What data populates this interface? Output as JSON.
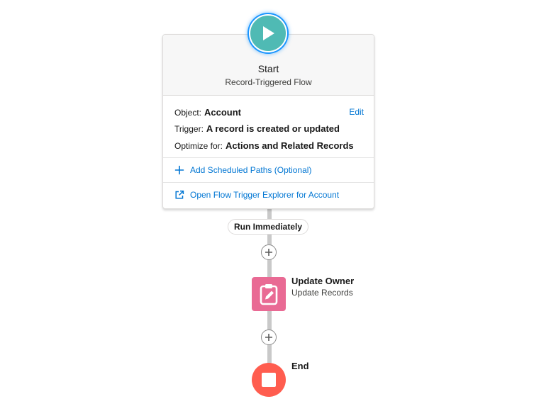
{
  "start": {
    "title": "Start",
    "subtitle": "Record-Triggered Flow",
    "object_label": "Object:",
    "object_value": "Account",
    "trigger_label": "Trigger:",
    "trigger_value": "A record is created or updated",
    "optimize_label": "Optimize for:",
    "optimize_value": "Actions and Related Records",
    "edit_label": "Edit",
    "scheduled_paths_label": "Add Scheduled Paths (Optional)",
    "explorer_label": "Open Flow Trigger Explorer for Account",
    "icon": "play-icon"
  },
  "path": {
    "label": "Run Immediately"
  },
  "element": {
    "title": "Update Owner",
    "subtitle": "Update Records",
    "icon": "clipboard-edit-icon"
  },
  "end": {
    "label": "End",
    "icon": "stop-icon"
  },
  "colors": {
    "start_icon": "#4fbab4",
    "update_icon": "#e96a94",
    "end_icon": "#ff5d4f",
    "link": "#0176d3",
    "connector": "#c9c9c9"
  }
}
